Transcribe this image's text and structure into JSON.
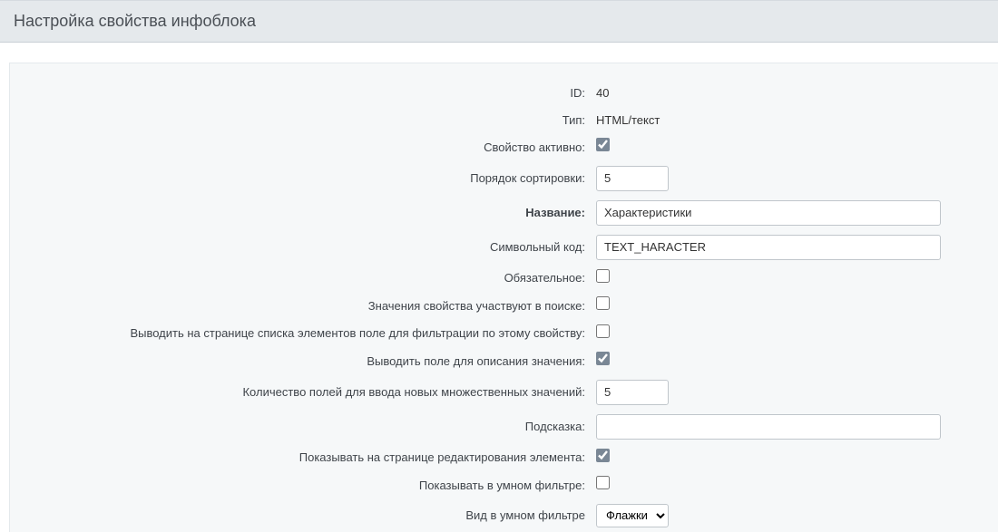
{
  "header": {
    "title": "Настройка свойства инфоблока"
  },
  "fields": {
    "id": {
      "label": "ID:",
      "value": "40"
    },
    "type": {
      "label": "Тип:",
      "value": "HTML/текст"
    },
    "active": {
      "label": "Свойство активно:",
      "checked": true
    },
    "sort": {
      "label": "Порядок сортировки:",
      "value": "5"
    },
    "name": {
      "label": "Название:",
      "value": "Характеристики"
    },
    "code": {
      "label": "Символьный код:",
      "value": "TEXT_HARACTER"
    },
    "required": {
      "label": "Обязательное:",
      "checked": false
    },
    "searchable": {
      "label": "Значения свойства участвуют в поиске:",
      "checked": false
    },
    "filtrable": {
      "label": "Выводить на странице списка элементов поле для фильтрации по этому свойству:",
      "checked": false
    },
    "with_description": {
      "label": "Выводить поле для описания значения:",
      "checked": true
    },
    "multiple_cnt": {
      "label": "Количество полей для ввода новых множественных значений:",
      "value": "5"
    },
    "hint": {
      "label": "Подсказка:",
      "value": ""
    },
    "show_on_edit": {
      "label": "Показывать на странице редактирования элемента:",
      "checked": true
    },
    "smart_filter": {
      "label": "Показывать в умном фильтре:",
      "checked": false
    },
    "smart_filter_view": {
      "label": "Вид в умном фильтре",
      "selected": "Флажки",
      "options": [
        "Флажки"
      ]
    }
  }
}
